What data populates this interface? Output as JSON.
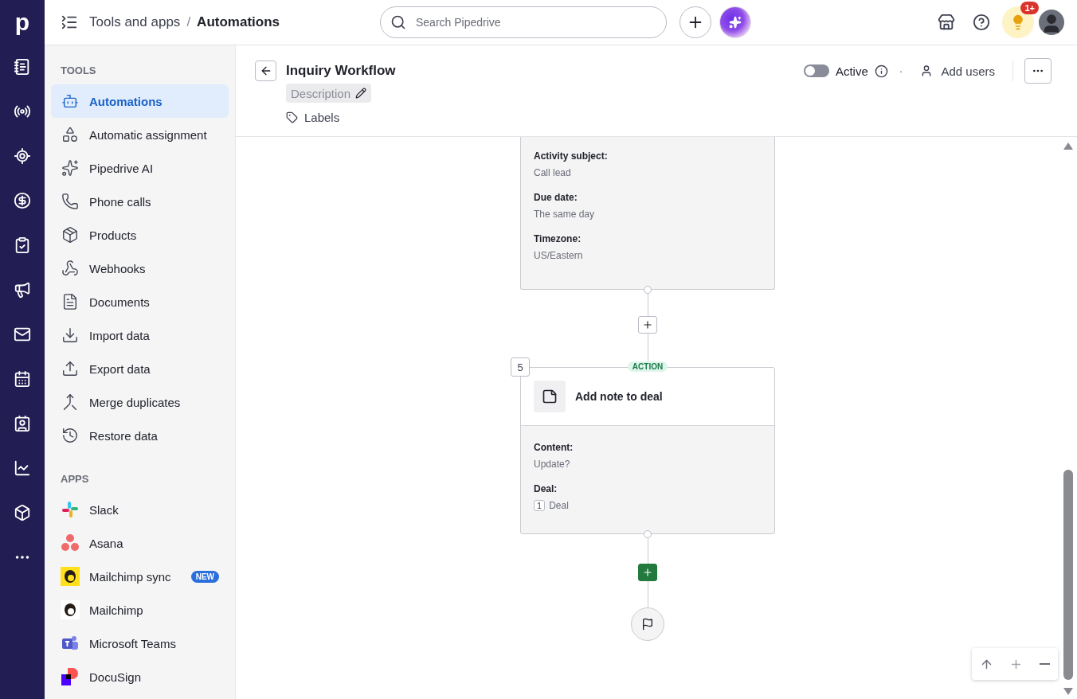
{
  "rail": {
    "logo": "p"
  },
  "topbar": {
    "breadcrumb": [
      "Tools and apps",
      "Automations"
    ],
    "separator": "/",
    "search": {
      "placeholder": "Search Pipedrive"
    },
    "notification_badge": "1+"
  },
  "sidebar": {
    "sections": [
      {
        "kind": "tools",
        "title": "TOOLS",
        "items": [
          {
            "label": "Automations",
            "selected": true
          },
          {
            "label": "Automatic assignment",
            "selected": false
          },
          {
            "label": "Pipedrive AI",
            "selected": false
          },
          {
            "label": "Phone calls",
            "selected": false
          },
          {
            "label": "Products",
            "selected": false
          },
          {
            "label": "Webhooks",
            "selected": false
          },
          {
            "label": "Documents",
            "selected": false
          },
          {
            "label": "Import data",
            "selected": false
          },
          {
            "label": "Export data",
            "selected": false
          },
          {
            "label": "Merge duplicates",
            "selected": false
          },
          {
            "label": "Restore data",
            "selected": false
          }
        ]
      },
      {
        "kind": "apps",
        "title": "APPS",
        "items": [
          {
            "label": "Slack",
            "selected": false
          },
          {
            "label": "Asana",
            "selected": false
          },
          {
            "label": "Mailchimp sync",
            "selected": false,
            "badge": "NEW"
          },
          {
            "label": "Mailchimp",
            "selected": false
          },
          {
            "label": "Microsoft Teams",
            "selected": false
          },
          {
            "label": "DocuSign",
            "selected": false
          }
        ]
      }
    ]
  },
  "header": {
    "title": "Inquiry Workflow",
    "description": "Description",
    "labels": "Labels",
    "active": {
      "label": "Active",
      "on": false
    },
    "separator": "·",
    "add_users": "Add users"
  },
  "flow": {
    "steps": [
      {
        "fields": [
          {
            "label": "Activity subject:",
            "value": "Call lead"
          },
          {
            "label": "Due date:",
            "value": "The same day"
          },
          {
            "label": "Timezone:",
            "value": "US/Eastern"
          }
        ]
      },
      {
        "number": "5",
        "tag": "ACTION",
        "title": "Add note to deal",
        "fields": [
          {
            "label": "Content:",
            "value": "Update?"
          },
          {
            "label": "Deal:",
            "chip": "1",
            "value": "Deal"
          }
        ]
      }
    ]
  }
}
